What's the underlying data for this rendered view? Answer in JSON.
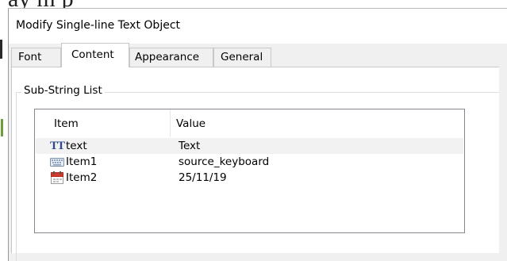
{
  "background": {
    "document_text": "ay    m    p"
  },
  "dialog": {
    "title": "Modify Single-line Text Object"
  },
  "tabs": [
    {
      "label": "Font",
      "active": false
    },
    {
      "label": "Content",
      "active": true
    },
    {
      "label": "Appearance",
      "active": false
    },
    {
      "label": "General",
      "active": false
    }
  ],
  "substring_group": {
    "label": "Sub-String List",
    "columns": [
      "Item",
      "Value"
    ],
    "rows": [
      {
        "icon": "text-type-icon",
        "item": "text",
        "value": "Text",
        "selected": true
      },
      {
        "icon": "keyboard-icon",
        "item": "Item1",
        "value": "source_keyboard",
        "selected": false
      },
      {
        "icon": "calendar-icon",
        "item": "Item2",
        "value": "25/11/19",
        "selected": false
      }
    ]
  },
  "colors": {
    "dialog_bg": "#f0f0f0",
    "panel_bg": "#ffffff",
    "selected_row": "#f2f2f2",
    "calendar_red": "#d63a2f",
    "text_icon_blue": "#2a4a8a"
  }
}
